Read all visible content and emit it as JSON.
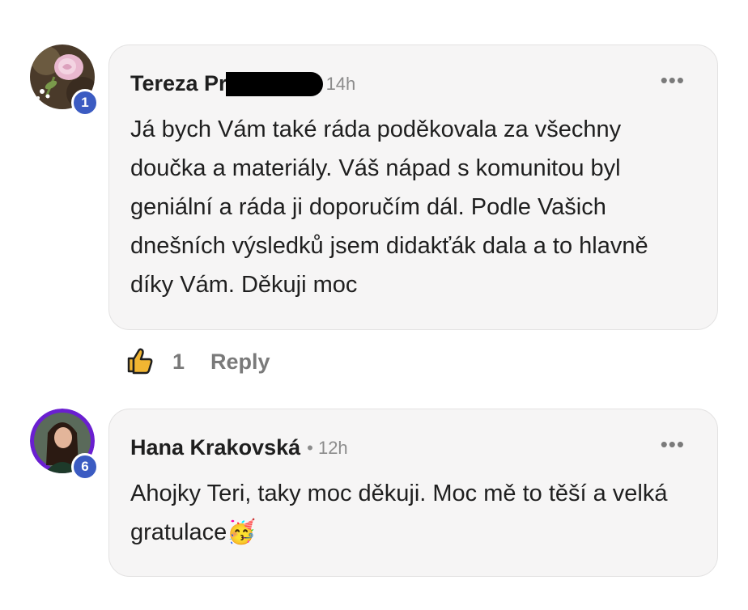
{
  "comments": [
    {
      "author": "Tereza Pr",
      "time": "14h",
      "text": "Já bych Vám také ráda poděkovala za všechny doučka a materiály. Váš nápad s komunitou byl geniální a ráda ji doporučím dál. Podle Vašich dnešních výsledků jsem didakťák dala a to hlavně díky Vám. Děkuji moc",
      "badge": "1",
      "likes": "1",
      "reply_label": "Reply",
      "more_label": "•••"
    },
    {
      "author": "Hana Krakovská",
      "time": "12h",
      "text": "Ahojky Teri, taky moc děkuji. Moc mě to těší a velká gratulace",
      "emoji": "🥳",
      "badge": "6",
      "more_label": "•••"
    }
  ],
  "colors": {
    "bubble_bg": "#f6f5f5",
    "badge_bg": "#3b5bc2",
    "like_icon": "#f2b632",
    "muted_text": "#7a7a7a"
  },
  "icons": {
    "like": "thumbs-up-icon",
    "more": "more-options-icon"
  }
}
